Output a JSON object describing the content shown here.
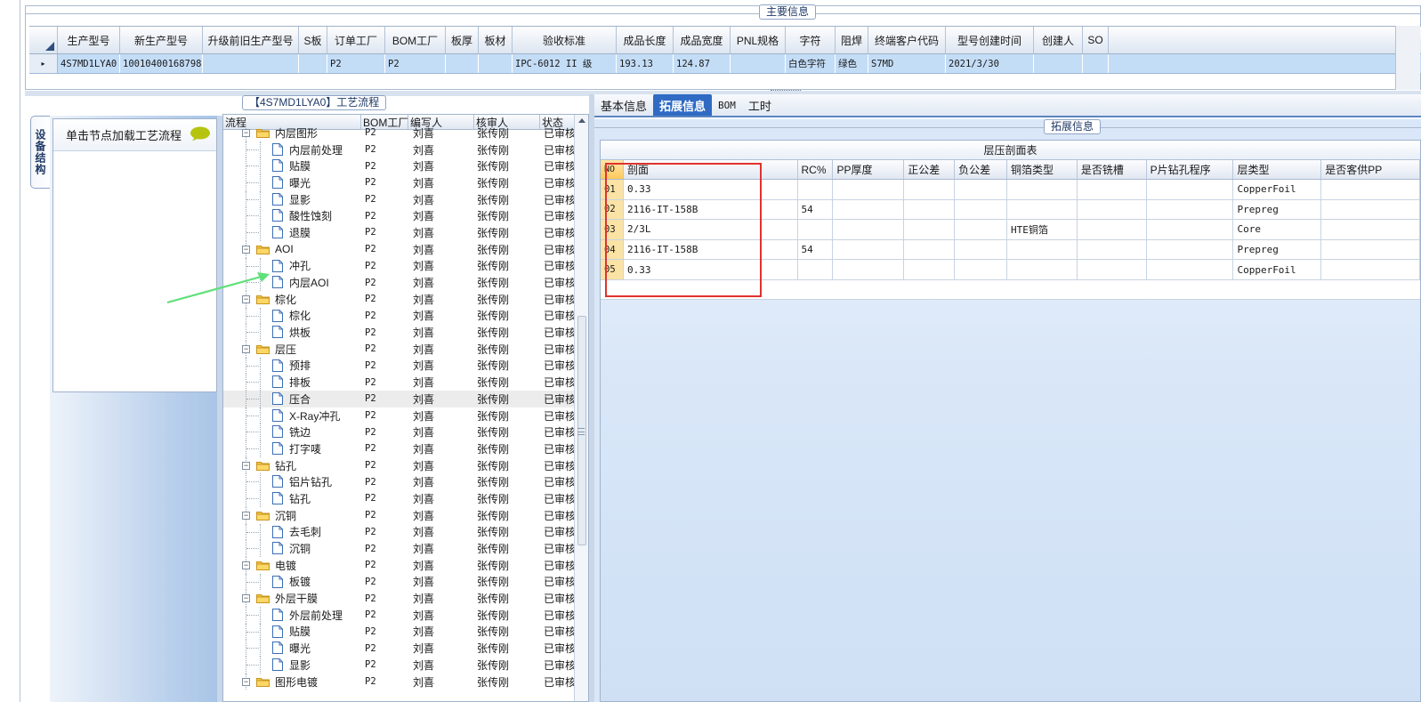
{
  "main_info": {
    "title": "主要信息",
    "columns": [
      "生产型号",
      "新生产型号",
      "升级前旧生产型号",
      "S板",
      "订单工厂",
      "BOM工厂",
      "板厚",
      "板材",
      "验收标准",
      "成品长度",
      "成品宽度",
      "PNL规格",
      "字符",
      "阻焊",
      "终端客户代码",
      "型号创建时间",
      "创建人",
      "SO"
    ],
    "row": [
      "4S7MD1LYA0",
      "10010400168798",
      "",
      "",
      "P2",
      "P2",
      "",
      "",
      "IPC-6012 II 级",
      "193.13",
      "124.87",
      "",
      "白色字符",
      "绿色",
      "S7MD",
      "2021/3/30",
      "",
      ""
    ],
    "row_indicator": "▸"
  },
  "process": {
    "title": "【4S7MD1LYA0】工艺流程",
    "vertical_tab": "设备结构",
    "tip": "单击节点加载工艺流程",
    "columns": [
      "流程",
      "BOM工厂",
      "编写人",
      "核审人",
      "状态"
    ],
    "rows": [
      {
        "name": "内层图形",
        "folder": true,
        "bom": "P2",
        "writer": "刘喜",
        "checker": "张传刚",
        "status": "已审核"
      },
      {
        "name": "内层前处理",
        "folder": false,
        "bom": "P2",
        "writer": "刘喜",
        "checker": "张传刚",
        "status": "已审核"
      },
      {
        "name": "贴膜",
        "folder": false,
        "bom": "P2",
        "writer": "刘喜",
        "checker": "张传刚",
        "status": "已审核"
      },
      {
        "name": "曝光",
        "folder": false,
        "bom": "P2",
        "writer": "刘喜",
        "checker": "张传刚",
        "status": "已审核"
      },
      {
        "name": "显影",
        "folder": false,
        "bom": "P2",
        "writer": "刘喜",
        "checker": "张传刚",
        "status": "已审核"
      },
      {
        "name": "酸性蚀刻",
        "folder": false,
        "bom": "P2",
        "writer": "刘喜",
        "checker": "张传刚",
        "status": "已审核"
      },
      {
        "name": "退膜",
        "folder": false,
        "bom": "P2",
        "writer": "刘喜",
        "checker": "张传刚",
        "status": "已审核"
      },
      {
        "name": "AOI",
        "folder": true,
        "bom": "P2",
        "writer": "刘喜",
        "checker": "张传刚",
        "status": "已审核"
      },
      {
        "name": "冲孔",
        "folder": false,
        "bom": "P2",
        "writer": "刘喜",
        "checker": "张传刚",
        "status": "已审核"
      },
      {
        "name": "内层AOI",
        "folder": false,
        "bom": "P2",
        "writer": "刘喜",
        "checker": "张传刚",
        "status": "已审核"
      },
      {
        "name": "棕化",
        "folder": true,
        "bom": "P2",
        "writer": "刘喜",
        "checker": "张传刚",
        "status": "已审核"
      },
      {
        "name": "棕化",
        "folder": false,
        "bom": "P2",
        "writer": "刘喜",
        "checker": "张传刚",
        "status": "已审核"
      },
      {
        "name": "烘板",
        "folder": false,
        "bom": "P2",
        "writer": "刘喜",
        "checker": "张传刚",
        "status": "已审核"
      },
      {
        "name": "层压",
        "folder": true,
        "bom": "P2",
        "writer": "刘喜",
        "checker": "张传刚",
        "status": "已审核"
      },
      {
        "name": "预排",
        "folder": false,
        "bom": "P2",
        "writer": "刘喜",
        "checker": "张传刚",
        "status": "已审核"
      },
      {
        "name": "排板",
        "folder": false,
        "bom": "P2",
        "writer": "刘喜",
        "checker": "张传刚",
        "status": "已审核"
      },
      {
        "name": "压合",
        "folder": false,
        "bom": "P2",
        "writer": "刘喜",
        "checker": "张传刚",
        "status": "已审核",
        "selected": true
      },
      {
        "name": "X-Ray冲孔",
        "folder": false,
        "bom": "P2",
        "writer": "刘喜",
        "checker": "张传刚",
        "status": "已审核"
      },
      {
        "name": "铣边",
        "folder": false,
        "bom": "P2",
        "writer": "刘喜",
        "checker": "张传刚",
        "status": "已审核"
      },
      {
        "name": "打字唛",
        "folder": false,
        "bom": "P2",
        "writer": "刘喜",
        "checker": "张传刚",
        "status": "已审核"
      },
      {
        "name": "钻孔",
        "folder": true,
        "bom": "P2",
        "writer": "刘喜",
        "checker": "张传刚",
        "status": "已审核"
      },
      {
        "name": "铝片钻孔",
        "folder": false,
        "bom": "P2",
        "writer": "刘喜",
        "checker": "张传刚",
        "status": "已审核"
      },
      {
        "name": "钻孔",
        "folder": false,
        "bom": "P2",
        "writer": "刘喜",
        "checker": "张传刚",
        "status": "已审核"
      },
      {
        "name": "沉铜",
        "folder": true,
        "bom": "P2",
        "writer": "刘喜",
        "checker": "张传刚",
        "status": "已审核"
      },
      {
        "name": "去毛刺",
        "folder": false,
        "bom": "P2",
        "writer": "刘喜",
        "checker": "张传刚",
        "status": "已审核"
      },
      {
        "name": "沉铜",
        "folder": false,
        "bom": "P2",
        "writer": "刘喜",
        "checker": "张传刚",
        "status": "已审核"
      },
      {
        "name": "电镀",
        "folder": true,
        "bom": "P2",
        "writer": "刘喜",
        "checker": "张传刚",
        "status": "已审核"
      },
      {
        "name": "板镀",
        "folder": false,
        "bom": "P2",
        "writer": "刘喜",
        "checker": "张传刚",
        "status": "已审核"
      },
      {
        "name": "外层干膜",
        "folder": true,
        "bom": "P2",
        "writer": "刘喜",
        "checker": "张传刚",
        "status": "已审核"
      },
      {
        "name": "外层前处理",
        "folder": false,
        "bom": "P2",
        "writer": "刘喜",
        "checker": "张传刚",
        "status": "已审核"
      },
      {
        "name": "贴膜",
        "folder": false,
        "bom": "P2",
        "writer": "刘喜",
        "checker": "张传刚",
        "status": "已审核"
      },
      {
        "name": "曝光",
        "folder": false,
        "bom": "P2",
        "writer": "刘喜",
        "checker": "张传刚",
        "status": "已审核"
      },
      {
        "name": "显影",
        "folder": false,
        "bom": "P2",
        "writer": "刘喜",
        "checker": "张传刚",
        "status": "已审核"
      },
      {
        "name": "图形电镀",
        "folder": true,
        "bom": "P2",
        "writer": "刘喜",
        "checker": "张传刚",
        "status": "已审核"
      }
    ]
  },
  "tabs": [
    "基本信息",
    "拓展信息",
    "BOM",
    "工时"
  ],
  "active_tab": "拓展信息",
  "ext_info": {
    "title": "拓展信息",
    "stack_title": "层压剖面表",
    "columns": [
      "NO",
      "剖面",
      "RC%",
      "PP厚度",
      "正公差",
      "负公差",
      "铜箔类型",
      "是否铣槽",
      "P片钻孔程序",
      "层类型",
      "是否客供PP"
    ],
    "rows": [
      [
        "01",
        "0.33",
        "",
        "",
        "",
        "",
        "",
        "",
        "",
        "CopperFoil",
        ""
      ],
      [
        "02",
        "2116-IT-158B",
        "54",
        "",
        "",
        "",
        "",
        "",
        "",
        "Prepreg",
        ""
      ],
      [
        "03",
        "2/3L",
        "",
        "",
        "",
        "",
        "HTE铜箔",
        "",
        "",
        "Core",
        ""
      ],
      [
        "04",
        "2116-IT-158B",
        "54",
        "",
        "",
        "",
        "",
        "",
        "",
        "Prepreg",
        ""
      ],
      [
        "05",
        "0.33",
        "",
        "",
        "",
        "",
        "",
        "",
        "",
        "CopperFoil",
        ""
      ]
    ]
  },
  "colors": {
    "selected_row": "#c4ddf7",
    "active_tab": "#2f6bc4",
    "highlight_box": "#e0322e",
    "annotation_arrow": "#5fe07a",
    "chat_icon": "#b6c40f"
  },
  "icons": [
    "chat-bubble-icon",
    "folder-icon",
    "document-icon",
    "expand-collapse-icon",
    "sort-corner-icon"
  ]
}
